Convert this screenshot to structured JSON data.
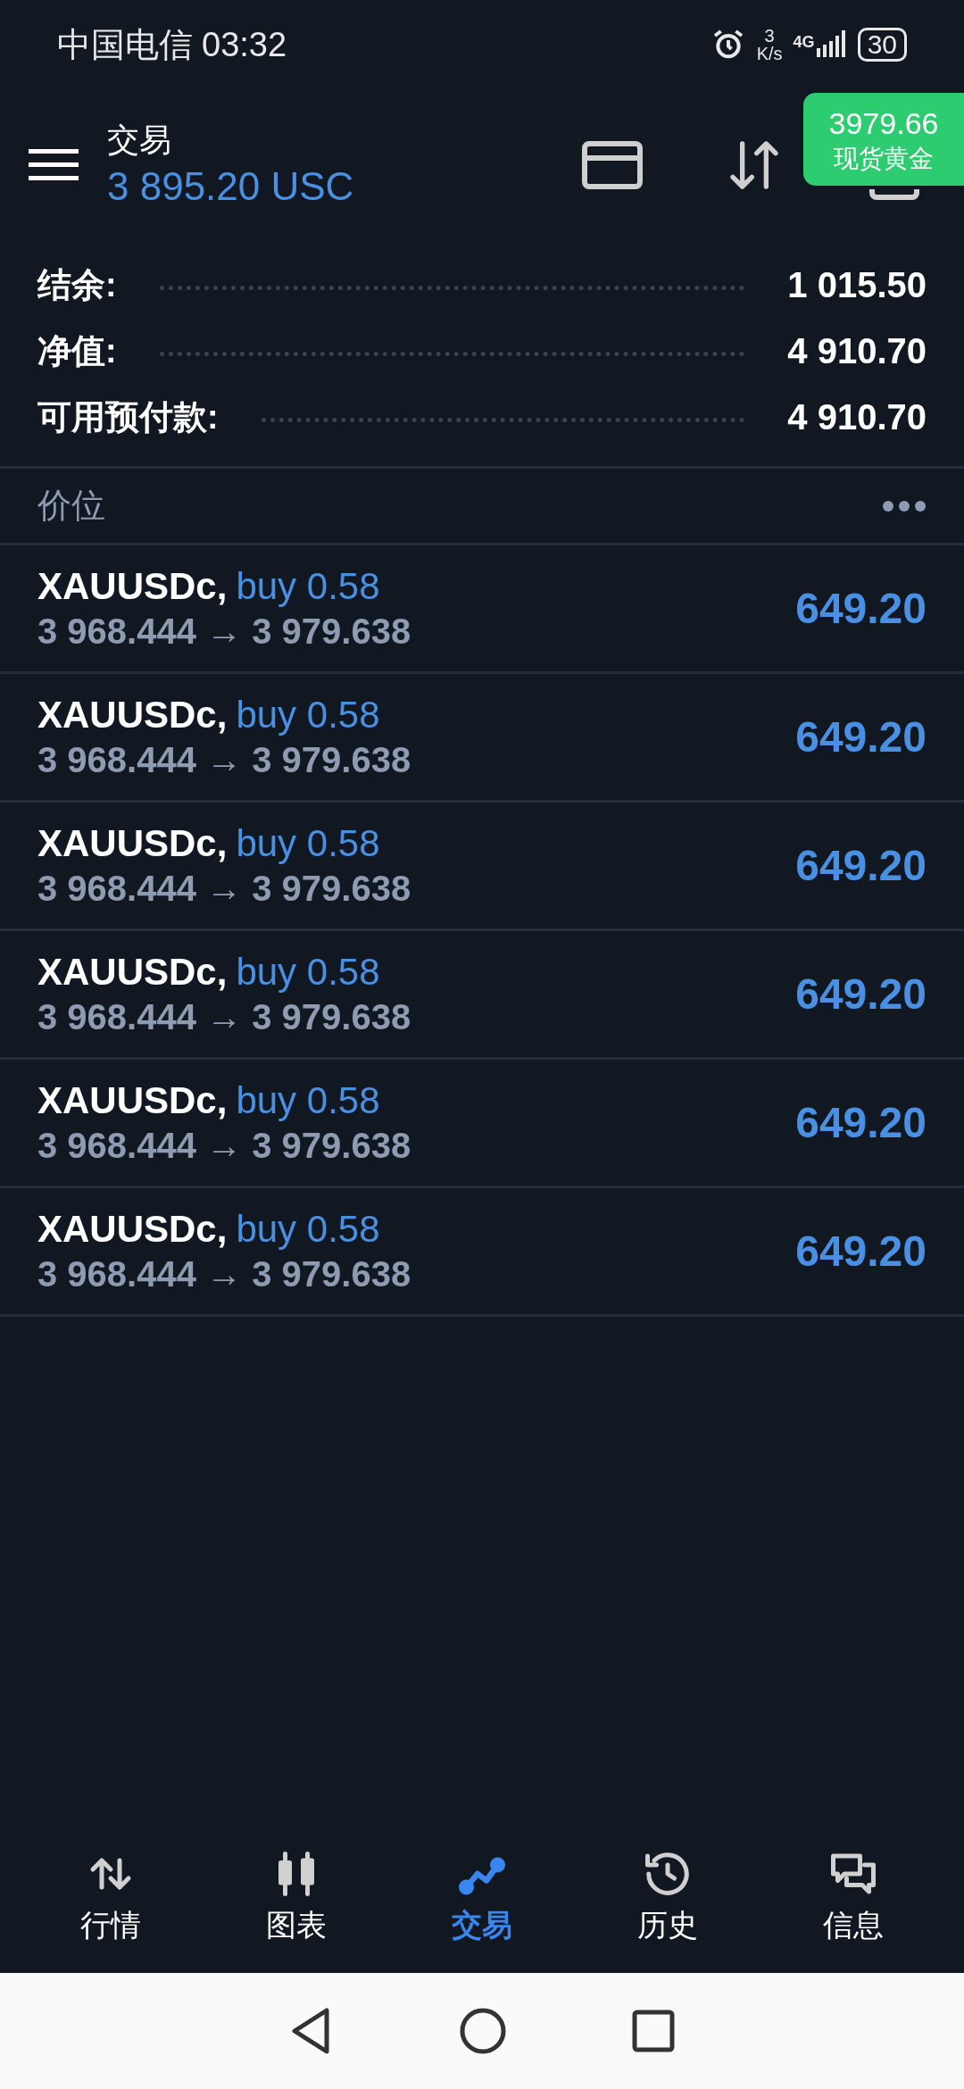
{
  "status_bar": {
    "carrier": "中国电信",
    "time": "03:32",
    "speed_value": "3",
    "speed_unit": "K/s",
    "network": "4G",
    "battery": "30"
  },
  "header": {
    "title": "交易",
    "balance": "3 895.20 USC"
  },
  "price_badge": {
    "price": "3979.66",
    "label": "现货黄金"
  },
  "summary": [
    {
      "label": "结余:",
      "value": "1 015.50"
    },
    {
      "label": "净值:",
      "value": "4 910.70"
    },
    {
      "label": "可用预付款:",
      "value": "4 910.70"
    }
  ],
  "positions_header": {
    "title": "价位"
  },
  "positions": [
    {
      "symbol": "XAUUSDc,",
      "order": "buy 0.58",
      "prices": "3 968.444 → 3 979.638",
      "profit": "649.20"
    },
    {
      "symbol": "XAUUSDc,",
      "order": "buy 0.58",
      "prices": "3 968.444 → 3 979.638",
      "profit": "649.20"
    },
    {
      "symbol": "XAUUSDc,",
      "order": "buy 0.58",
      "prices": "3 968.444 → 3 979.638",
      "profit": "649.20"
    },
    {
      "symbol": "XAUUSDc,",
      "order": "buy 0.58",
      "prices": "3 968.444 → 3 979.638",
      "profit": "649.20"
    },
    {
      "symbol": "XAUUSDc,",
      "order": "buy 0.58",
      "prices": "3 968.444 → 3 979.638",
      "profit": "649.20"
    },
    {
      "symbol": "XAUUSDc,",
      "order": "buy 0.58",
      "prices": "3 968.444 → 3 979.638",
      "profit": "649.20"
    }
  ],
  "bottom_nav": [
    {
      "label": "行情",
      "kind": "quotes",
      "selected": false
    },
    {
      "label": "图表",
      "kind": "chart",
      "selected": false
    },
    {
      "label": "交易",
      "kind": "trade",
      "selected": true
    },
    {
      "label": "历史",
      "kind": "history",
      "selected": false
    },
    {
      "label": "信息",
      "kind": "messages",
      "selected": false
    }
  ]
}
